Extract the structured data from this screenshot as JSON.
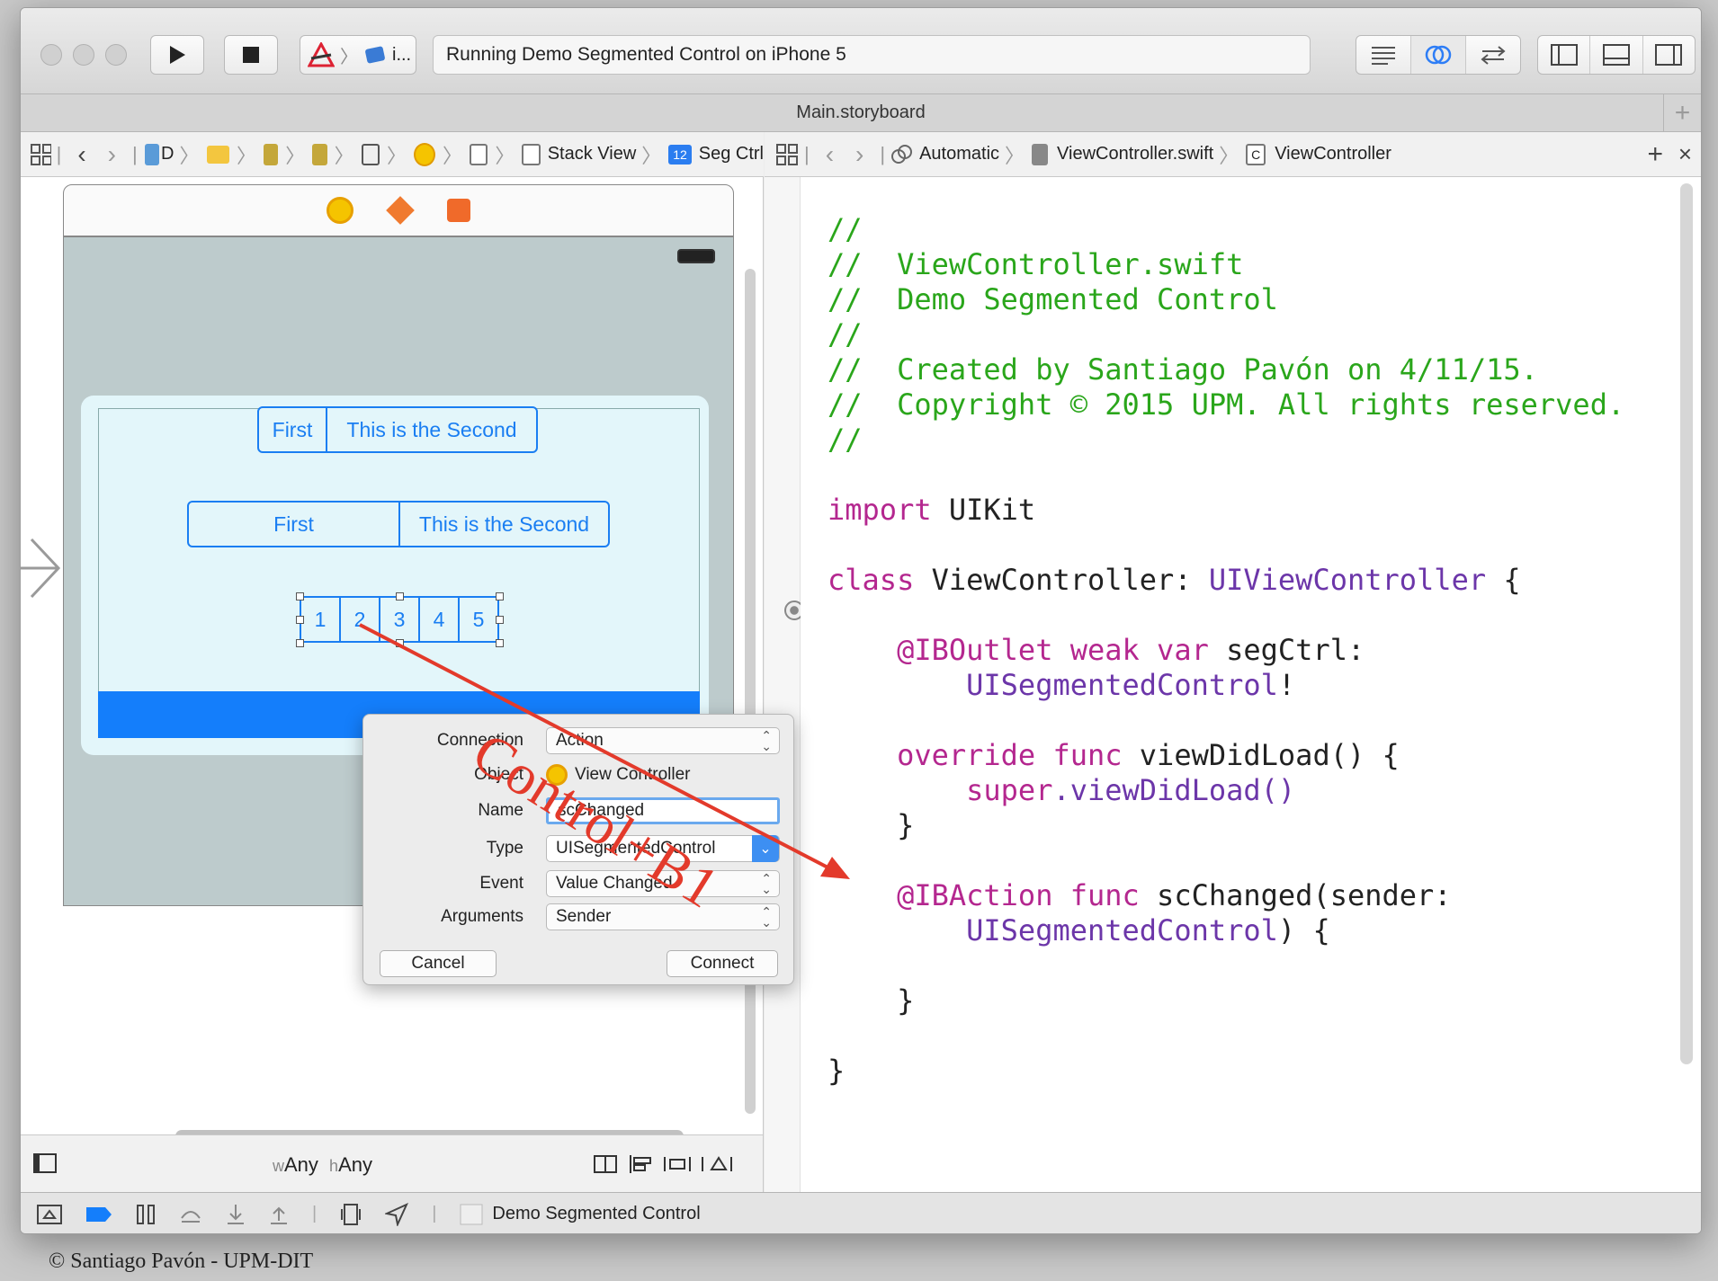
{
  "toolbar": {
    "scheme": "i...",
    "status": "Running Demo Segmented Control on iPhone 5"
  },
  "tab": {
    "title": "Main.storyboard"
  },
  "left_jumpbar": {
    "items": [
      "D",
      "Stack View",
      "Seg Ctrl"
    ]
  },
  "right_jumpbar": {
    "mode": "Automatic",
    "file": "ViewController.swift",
    "class": "ViewController"
  },
  "scene": {
    "seg1": [
      "First",
      "This is the Second"
    ],
    "seg2": [
      "First",
      "This is the Second"
    ],
    "seg3": [
      "1",
      "2",
      "3",
      "4",
      "5"
    ]
  },
  "size_class": {
    "w_prefix": "w",
    "w": "Any",
    "h_prefix": "h",
    "h": "Any"
  },
  "code": {
    "l1": "//",
    "l2": "//  ViewController.swift",
    "l3": "//  Demo Segmented Control",
    "l4": "//",
    "l5": "//  Created by Santiago Pavón on 4/11/15.",
    "l6": "//  Copyright © 2015 UPM. All rights reserved.",
    "l7": "//",
    "import_kw": "import",
    "import_mod": " UIKit",
    "class_kw": "class",
    "class_name": " ViewController: ",
    "class_super": "UIViewController",
    "class_brace": " {",
    "outlet_attr": "    @IBOutlet",
    "outlet_kw": " weak var",
    "outlet_name": " segCtrl:",
    "outlet_type": "        UISegmentedControl",
    "outlet_bang": "!",
    "override_kw": "    override func",
    "vdl": " viewDidLoad() {",
    "super_kw": "        super",
    "super_call": ".viewDidLoad()",
    "close1": "    }",
    "action_attr": "    @IBAction",
    "action_kw": " func",
    "action_name": " scChanged(sender:",
    "action_type": "        UISegmentedControl",
    "action_tail": ") {",
    "close2": "    }",
    "close3": "}"
  },
  "popup": {
    "connection_label": "Connection",
    "connection_value": "Action",
    "object_label": "Object",
    "object_value": "View Controller",
    "name_label": "Name",
    "name_value": "scChanged",
    "type_label": "Type",
    "type_value": "UISegmentedControl",
    "event_label": "Event",
    "event_value": "Value Changed",
    "arguments_label": "Arguments",
    "arguments_value": "Sender",
    "cancel": "Cancel",
    "connect": "Connect"
  },
  "annotation": {
    "text": "Control+B1",
    "color": "#e33a2b"
  },
  "debug": {
    "target": "Demo Segmented Control"
  },
  "footer": {
    "copyright": "© Santiago Pavón - UPM-DIT"
  },
  "colors": {
    "accent": "#147efb",
    "comment": "#2aa61b",
    "keyword": "#b4278f",
    "type": "#6c36a9"
  }
}
